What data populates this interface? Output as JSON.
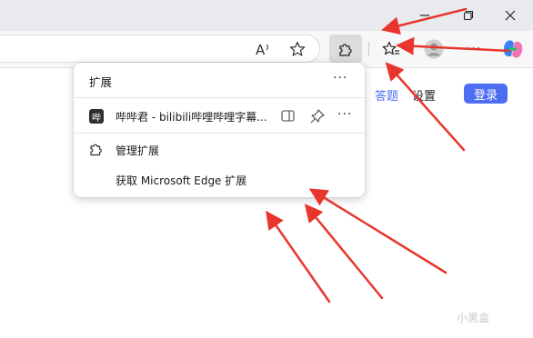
{
  "browser": {
    "window_controls": [
      "minimize",
      "restore",
      "close"
    ],
    "toolbar": {
      "read_aloud_label": "A",
      "more_label": "···",
      "extensions_button_icon": "puzzle-icon"
    }
  },
  "page": {
    "links": [
      "答题",
      "设置"
    ],
    "login_label": "登录"
  },
  "extensions_panel": {
    "title": "扩展",
    "more_label": "···",
    "item": {
      "logo_text": "哔",
      "name": "哔哔君 - bilibili哔哩哔哩字幕...",
      "more_label": "···"
    },
    "manage_label": "管理扩展",
    "get_label": "获取 Microsoft Edge 扩展"
  },
  "watermark": "小黑盒",
  "colors": {
    "arrow": "#e8362d",
    "login_button": "#4e6ef2",
    "link": "#4e6ef2"
  }
}
